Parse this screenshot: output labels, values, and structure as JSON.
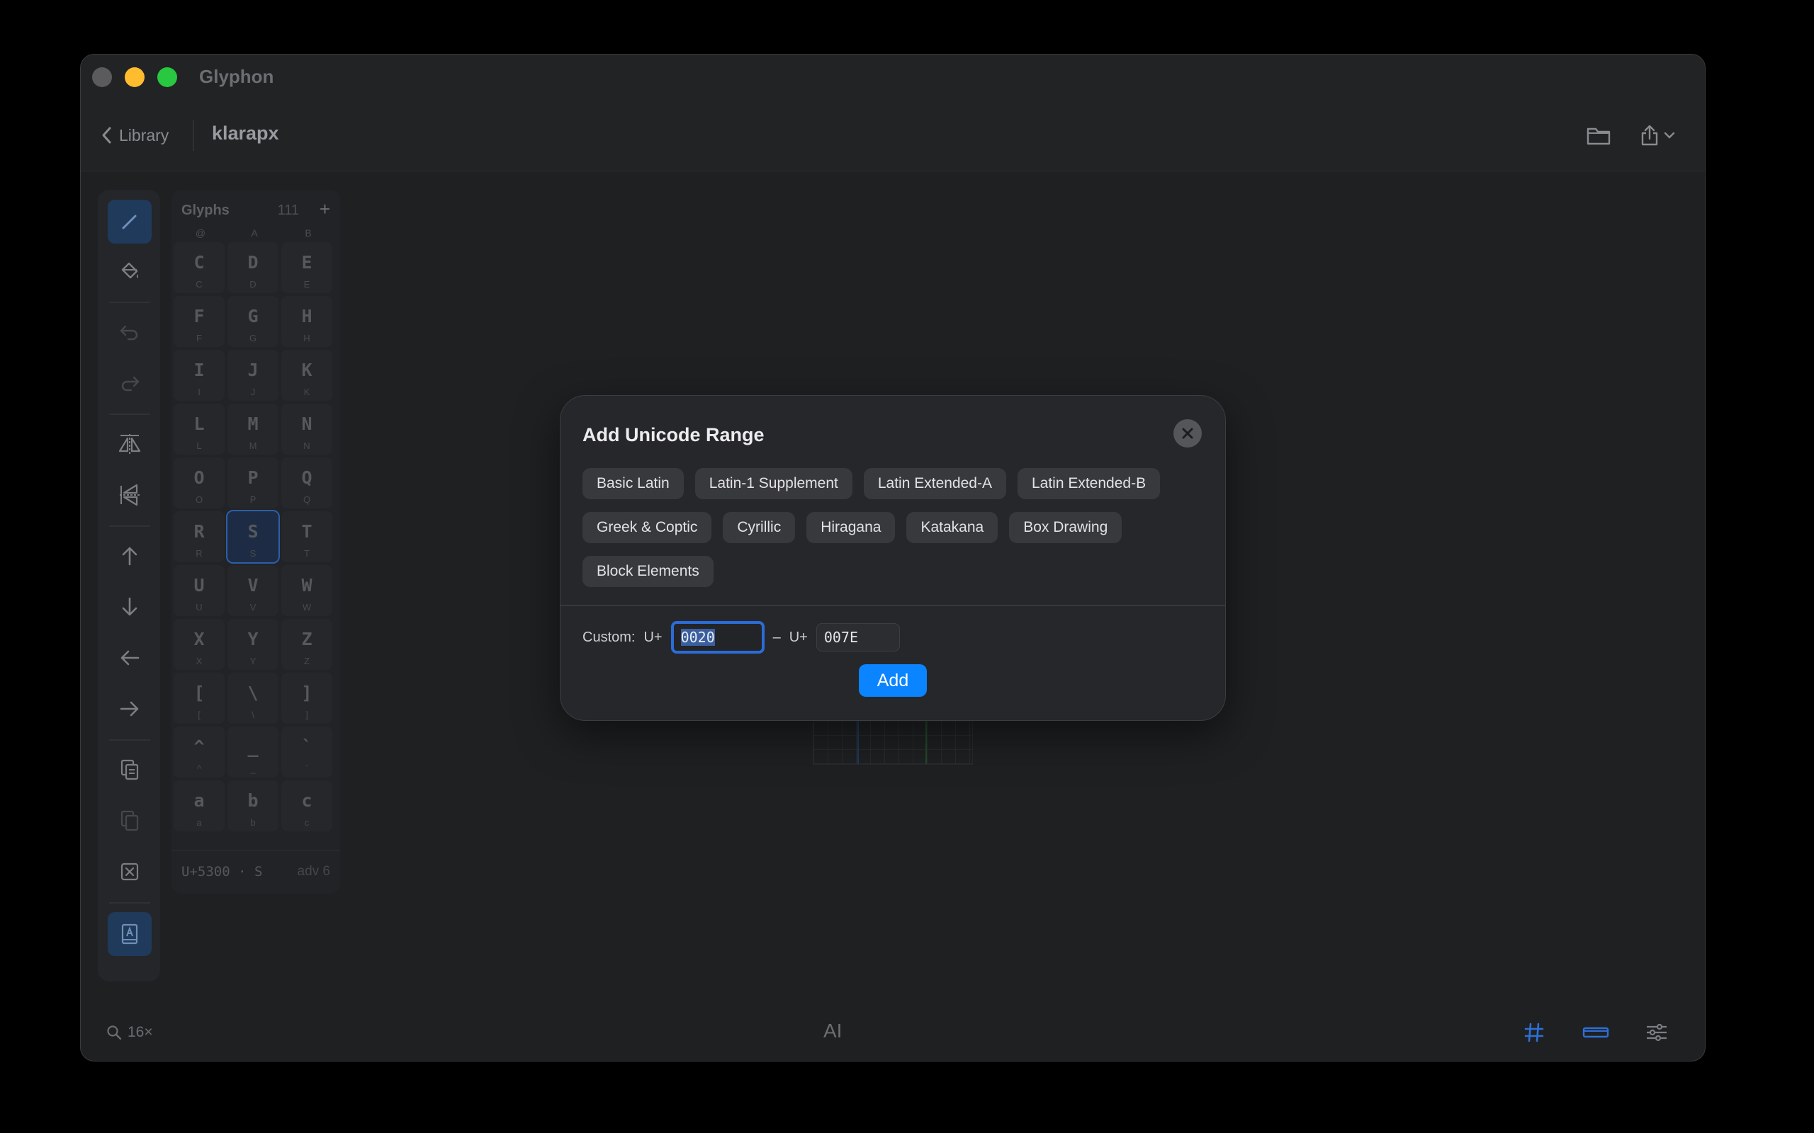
{
  "window": {
    "app_title": "Glyphon"
  },
  "toolbar": {
    "back_label": "Library",
    "doc_title": "klarapx",
    "folder_icon": "folder-icon",
    "share_icon": "share-icon"
  },
  "tools": [
    {
      "name": "pencil-icon",
      "active": true
    },
    {
      "name": "paint-bucket-icon",
      "active": false
    },
    {
      "name": "undo-icon",
      "active": false
    },
    {
      "name": "redo-icon",
      "active": false
    },
    {
      "name": "flip-horizontal-icon",
      "active": false
    },
    {
      "name": "flip-vertical-icon",
      "active": false
    },
    {
      "name": "arrow-up-icon",
      "active": false
    },
    {
      "name": "arrow-down-icon",
      "active": false
    },
    {
      "name": "arrow-left-icon",
      "active": false
    },
    {
      "name": "arrow-right-icon",
      "active": false
    },
    {
      "name": "copy-icon",
      "active": false
    },
    {
      "name": "paste-icon",
      "active": false
    },
    {
      "name": "clear-icon",
      "active": false
    },
    {
      "name": "font-book-icon",
      "active": true
    }
  ],
  "glyph_panel": {
    "title": "Glyphs",
    "count": "111",
    "add_label": "+",
    "partial_row": [
      "@",
      "A",
      "B"
    ],
    "cells": [
      {
        "glyph": "C",
        "label": "C"
      },
      {
        "glyph": "D",
        "label": "D"
      },
      {
        "glyph": "E",
        "label": "E"
      },
      {
        "glyph": "F",
        "label": "F"
      },
      {
        "glyph": "G",
        "label": "G"
      },
      {
        "glyph": "H",
        "label": "H"
      },
      {
        "glyph": "I",
        "label": "I"
      },
      {
        "glyph": "J",
        "label": "J"
      },
      {
        "glyph": "K",
        "label": "K"
      },
      {
        "glyph": "L",
        "label": "L"
      },
      {
        "glyph": "M",
        "label": "M"
      },
      {
        "glyph": "N",
        "label": "N"
      },
      {
        "glyph": "O",
        "label": "O"
      },
      {
        "glyph": "P",
        "label": "P"
      },
      {
        "glyph": "Q",
        "label": "Q"
      },
      {
        "glyph": "R",
        "label": "R"
      },
      {
        "glyph": "S",
        "label": "S",
        "selected": true
      },
      {
        "glyph": "T",
        "label": "T"
      },
      {
        "glyph": "U",
        "label": "U"
      },
      {
        "glyph": "V",
        "label": "V"
      },
      {
        "glyph": "W",
        "label": "W"
      },
      {
        "glyph": "X",
        "label": "X"
      },
      {
        "glyph": "Y",
        "label": "Y"
      },
      {
        "glyph": "Z",
        "label": "Z"
      },
      {
        "glyph": "[",
        "label": "["
      },
      {
        "glyph": "\\",
        "label": "\\"
      },
      {
        "glyph": "]",
        "label": "]"
      },
      {
        "glyph": "^",
        "label": "^"
      },
      {
        "glyph": "_",
        "label": "_"
      },
      {
        "glyph": "`",
        "label": "`"
      },
      {
        "glyph": "a",
        "label": "a"
      },
      {
        "glyph": "b",
        "label": "b"
      },
      {
        "glyph": "c",
        "label": "c"
      }
    ],
    "footer_left": "U+5300 · S",
    "footer_right": "adv 6"
  },
  "statusbar": {
    "zoom": "16×",
    "text_tool": "AI"
  },
  "modal": {
    "title": "Add Unicode Range",
    "chips": [
      "Basic Latin",
      "Latin-1 Supplement",
      "Latin Extended-A",
      "Latin Extended-B",
      "Greek & Coptic",
      "Cyrillic",
      "Hiragana",
      "Katakana",
      "Box Drawing",
      "Block Elements"
    ],
    "custom_label": "Custom:",
    "prefix_start": "U+",
    "start_value": "0020",
    "range_dash": "–",
    "prefix_end": "U+",
    "end_value": "007E",
    "add_label": "Add"
  },
  "colors": {
    "accent": "#0a84ff",
    "selection": "#2b6cd8"
  }
}
